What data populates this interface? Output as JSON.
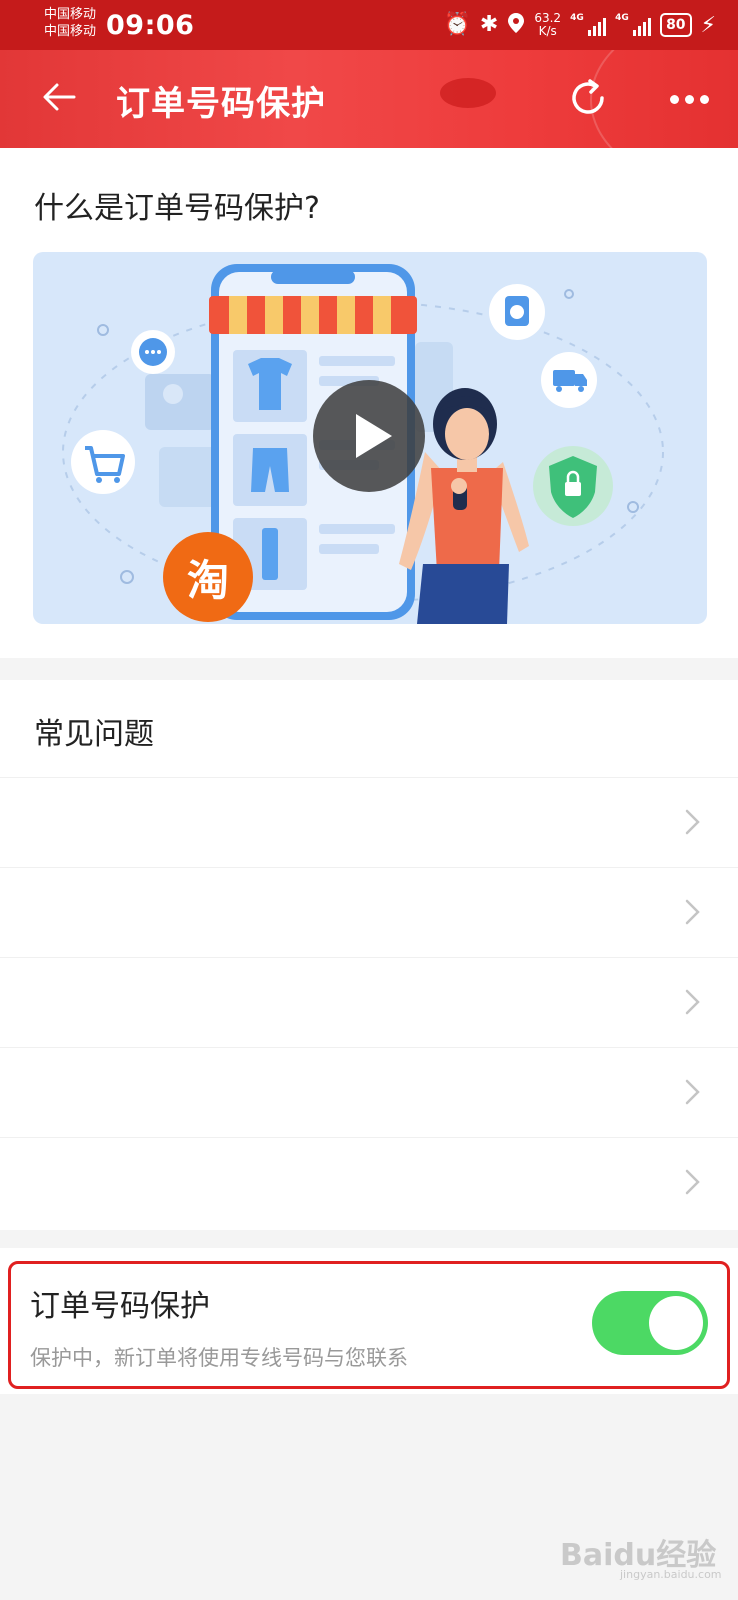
{
  "status_bar": {
    "carrier_1": "中国移动",
    "carrier_2": "中国移动",
    "time": "09:06",
    "speed_value": "63.2",
    "speed_unit": "K/s",
    "network_1": "4G",
    "network_2": "4G",
    "battery": "80",
    "icons": [
      "alarm-icon",
      "bluetooth-icon",
      "location-icon",
      "signal-icon",
      "signal-icon",
      "battery-icon",
      "charging-icon"
    ]
  },
  "nav": {
    "title": "订单号码保护",
    "icons": [
      "back-arrow-icon",
      "refresh-icon",
      "more-icon"
    ],
    "background_color": "#e83b3b"
  },
  "intro": {
    "title": "什么是订单号码保护?",
    "video_logo_text": "淘"
  },
  "faq": {
    "title": "常见问题",
    "items": [
      {
        "label": ""
      },
      {
        "label": ""
      },
      {
        "label": ""
      },
      {
        "label": ""
      },
      {
        "label": ""
      }
    ]
  },
  "protection": {
    "title": "订单号码保护",
    "subtitle": "保护中，新订单将使用专线号码与您联系",
    "toggle_on": true,
    "toggle_color": "#4cd964"
  },
  "watermark": {
    "main": "Baidu经验",
    "sub": "jingyan.baidu.com"
  }
}
